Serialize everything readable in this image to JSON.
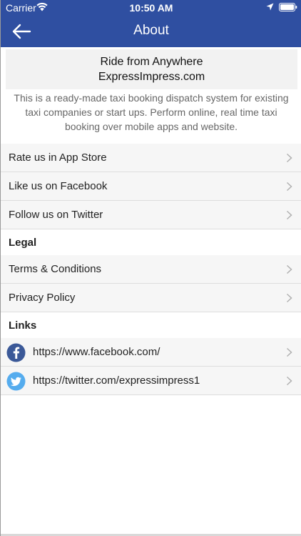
{
  "status_bar": {
    "carrier": "Carrier",
    "time": "10:50 AM"
  },
  "header": {
    "title": "About"
  },
  "about": {
    "heading_line1": "Ride from Anywhere",
    "heading_line2": "ExpressImpress.com",
    "description": "This is a ready-made taxi booking dispatch system for existing taxi companies or start ups. Perform online, real time taxi booking over mobile apps and website."
  },
  "menu": {
    "items": [
      {
        "label": "Rate us in App Store"
      },
      {
        "label": "Like us on Facebook"
      },
      {
        "label": "Follow us on Twitter"
      }
    ]
  },
  "legal": {
    "title": "Legal",
    "items": [
      {
        "label": "Terms & Conditions"
      },
      {
        "label": "Privacy Policy"
      }
    ]
  },
  "links": {
    "title": "Links",
    "items": [
      {
        "label": "https://www.facebook.com/",
        "icon": "facebook-icon"
      },
      {
        "label": "https://twitter.com/expressimpress1",
        "icon": "twitter-icon"
      }
    ]
  },
  "colors": {
    "header_bg": "#2f4fa1",
    "facebook": "#3b5998",
    "twitter": "#55acee"
  }
}
